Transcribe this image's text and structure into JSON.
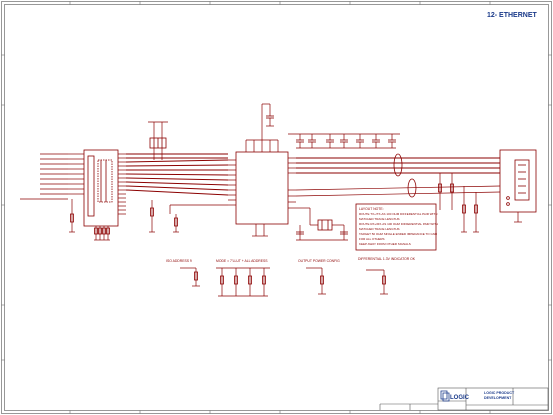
{
  "sheet": {
    "title": "12- ETHERNET"
  },
  "sections": {
    "section_a": "ISO ADDRESS 9",
    "section_b": "MODE = 7'LLUT + ALL ADDRESS",
    "section_c": "OUTPUT POWER CONFIG",
    "section_d": "DIFFERENTIAL 1.3V INDICATOR OK"
  },
  "notes": {
    "header": "LAYOUT NOTE:",
    "lines": [
      "ROUTE TX+/TX-AS 100 OHM DIFFERENTIAL PAIR WITH",
      "MATCHED TRACE LENGTHS",
      "ROUTE RX+/RX-AS 100 OHM DIFFERENTIAL PAIR WITH",
      "MATCHED TRACE LENGTHS",
      "TARGET 50 OHM SINGLE ENDED IMPEDANCE TO GND",
      "FOR ALL OTHERS",
      "KEEP AWAY FROM OTHER SIGNALS"
    ]
  },
  "title_block": {
    "company_line1": "LOGIC PRODUCT",
    "company_line2": "DEVELOPMENT",
    "logo_text": "LOGIC"
  },
  "colors": {
    "schematic": "#8b0000",
    "net": "#cc0000",
    "frame": "#555555",
    "title": "#1a3a8a"
  }
}
